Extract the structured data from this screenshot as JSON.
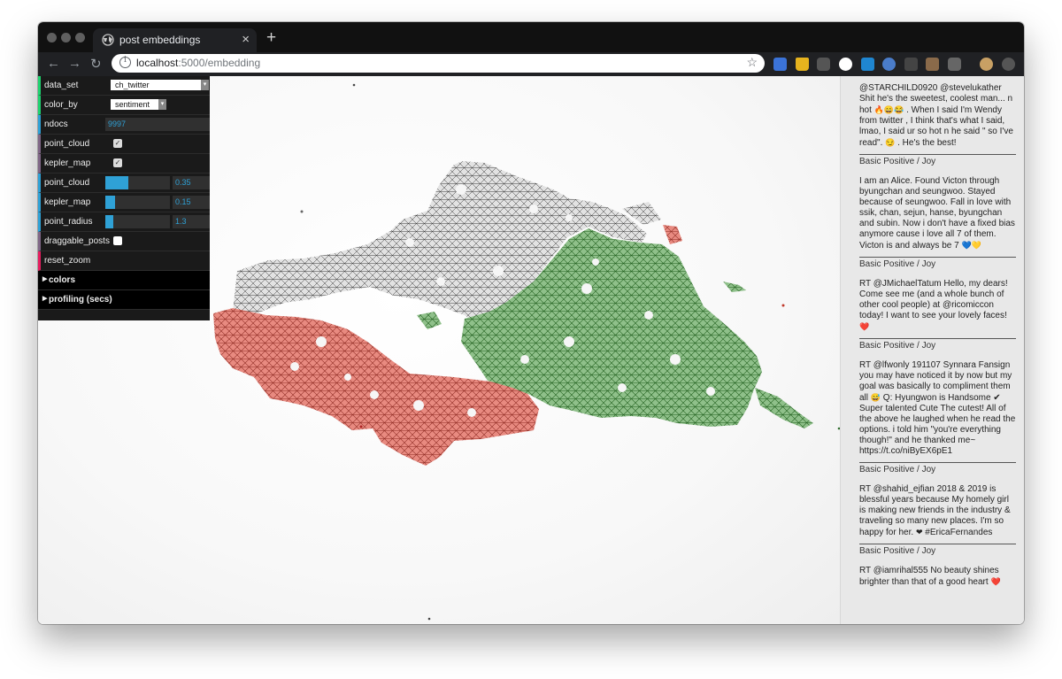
{
  "browser": {
    "tab_title": "post embeddings",
    "url_host": "localhost",
    "url_path": ":5000/embedding",
    "new_tab": "+",
    "close_tab": "×"
  },
  "gui": {
    "data_set": {
      "label": "data_set",
      "value": "ch_twitter"
    },
    "color_by": {
      "label": "color_by",
      "value": "sentiment"
    },
    "ndocs": {
      "label": "ndocs",
      "value": "9997"
    },
    "point_cloud_toggle": {
      "label": "point_cloud",
      "checked": true
    },
    "kepler_map_toggle": {
      "label": "kepler_map",
      "checked": true
    },
    "point_cloud_slider": {
      "label": "point_cloud",
      "value": "0.35",
      "fraction": 0.35
    },
    "kepler_map_slider": {
      "label": "kepler_map",
      "value": "0.15",
      "fraction": 0.15
    },
    "point_radius": {
      "label": "point_radius",
      "value": "1.3",
      "fraction": 0.13
    },
    "draggable_posts": {
      "label": "draggable_posts",
      "checked": false
    },
    "reset_zoom": {
      "label": "reset_zoom"
    },
    "folders": {
      "colors": "colors",
      "profiling": "profiling (secs)"
    }
  },
  "colors": {
    "negative": "#d24a3f",
    "neutral": "#8a8a8a",
    "positive": "#3e8a3a",
    "string_border": "#1ed36f",
    "number_border": "#2fa1d6",
    "bool_border": "#806787",
    "function_border": "#e61d5f"
  },
  "posts": [
    {
      "text_a": "@STARCHILD0920 @stevelukather Shit he's the sweetest, coolest man... n hot ",
      "emoji_a": "🔥😄😂",
      "text_b": " . When I said I'm Wendy from twitter , I think that's what I said, lmao, I said ur so hot n he said \" so I've read\". ",
      "emoji_b": "😏",
      "text_c": " . He's the best!",
      "sentiment": "Basic Positive / Joy"
    },
    {
      "text_a": "I am an Alice. Found Victon through byungchan and seungwoo. Stayed because of seungwoo. Fall in love with ssik, chan, sejun, hanse, byungchan and subin. Now i don't have a fixed bias anymore cause i love all 7 of them. Victon is and always be 7 ",
      "emoji_a": "💙💛",
      "text_b": "",
      "emoji_b": "",
      "text_c": "",
      "sentiment": "Basic Positive / Joy"
    },
    {
      "text_a": "RT @JMichaelTatum Hello, my dears! Come see me (and a whole bunch of other cool people) at @ricomiccon today! I want to see your lovely faces! ",
      "emoji_a": "❤️",
      "text_b": "",
      "emoji_b": "",
      "text_c": "",
      "sentiment": "Basic Positive / Joy"
    },
    {
      "text_a": "RT @lfwonly 191107 Synnara Fansign you may have noticed it by now but my goal was basically to compliment them all ",
      "emoji_a": "😅",
      "text_b": "  Q: Hyungwon is Handsome ✔ Super talented Cute The cutest! All of the above he laughed when he read the options. i told him \"you're everything though!\" and he thanked me~ https://t.co/niByEX6pE1",
      "emoji_b": "",
      "text_c": "",
      "sentiment": "Basic Positive / Joy"
    },
    {
      "text_a": "RT @shahid_ejfian 2018 & 2019 is blessful years because My homely girl is making new friends in the industry & traveling so many new places. I'm so happy for her. ",
      "emoji_a": "❤",
      "text_b": " #EricaFernandes",
      "emoji_b": "",
      "text_c": "",
      "sentiment": "Basic Positive / Joy"
    },
    {
      "text_a": "RT @iamrihal555 No beauty shines brighter than that of a good heart ",
      "emoji_a": "❤️",
      "text_b": "",
      "emoji_b": "",
      "text_c": "",
      "sentiment": ""
    }
  ]
}
